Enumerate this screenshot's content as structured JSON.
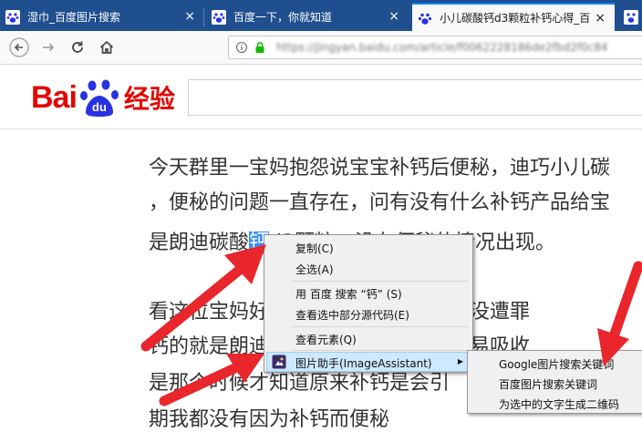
{
  "tabs": [
    {
      "title": "湿巾_百度图片搜索",
      "close": "×",
      "active": false
    },
    {
      "title": "百度一下，你就知道",
      "close": "×",
      "active": false
    },
    {
      "title": "小儿碳酸钙d3颗粒补钙心得_百",
      "close": "×",
      "active": true
    }
  ],
  "nav": {
    "back": "←",
    "forward": "→",
    "reload": "C",
    "home": "⌂",
    "url": "https://jingyan.baidu.com/article/f0062228186de2fbd2f0c84"
  },
  "header": {
    "logo_text": "Bai",
    "logo_du": "du",
    "logo_jingyan": "经验"
  },
  "article": {
    "line1": "今天群里一宝妈抱怨说宝宝补钙后便秘，迪巧小儿碳",
    "line2": "，便秘的问题一直存在，问有没有什么补钙产品给宝",
    "line3_before": "是朗迪碳酸",
    "line3_selected": "钙",
    "line3_after": "d3颗粒，没有便秘的情况出现。",
    "line4_a": "看这位宝妈好",
    "line4_b": "自己和孩子都没遭罪",
    "line5_a": "钙的就是朗迪",
    "line5_b": "钙含量高，易吸收",
    "line6_a": "是那个时候才知道原来补钙是会引",
    "line7_a": "期我都没有因为补钙而便秘"
  },
  "context_menu": {
    "copy": "复制(C)",
    "select_all": "全选(A)",
    "search_baidu": "用 百度 搜索 “钙” (S)",
    "view_source": "查看选中部分源代码(E)",
    "inspect": "查看元素(Q)",
    "image_assistant": "图片助手(ImageAssistant)",
    "submenu_arrow": "▶"
  },
  "submenu": {
    "google": "Google图片搜索关键词",
    "baidu": "百度图片搜索关键词",
    "qr": "为选中的文字生成二维码"
  },
  "colors": {
    "tabbar": "#1f4f8f",
    "accent": "#0a84ff",
    "baidu_red": "#e10602",
    "baidu_blue": "#2932e1",
    "arrow_red": "#e8262b"
  }
}
